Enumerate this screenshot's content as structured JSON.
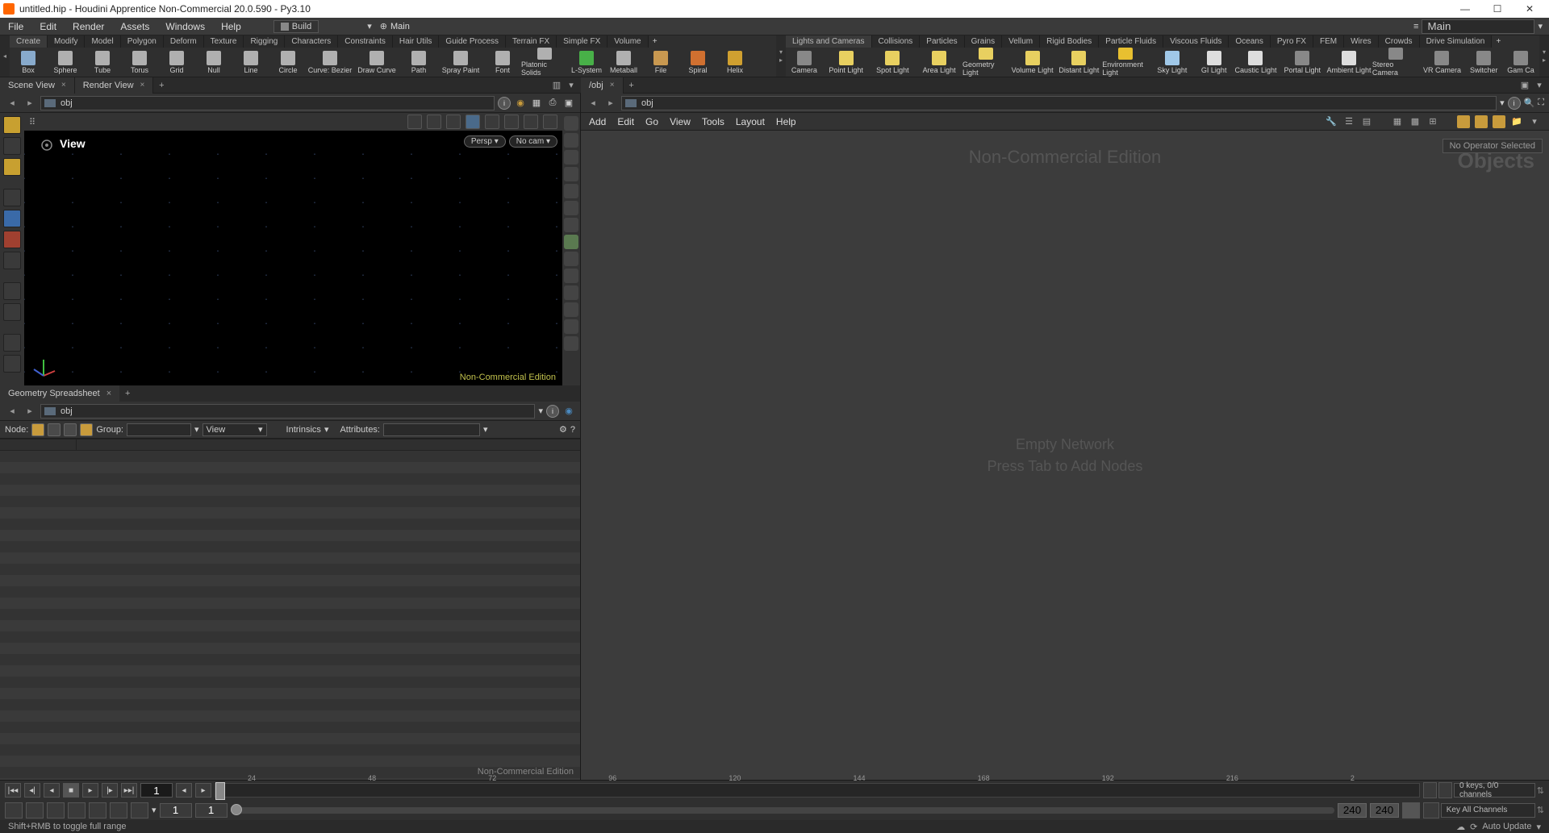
{
  "titlebar": {
    "title": "untitled.hip - Houdini Apprentice Non-Commercial 20.0.590 - Py3.10"
  },
  "menubar": {
    "items": [
      "File",
      "Edit",
      "Render",
      "Assets",
      "Windows",
      "Help"
    ],
    "build_label": "Build",
    "main_label": "Main",
    "right_input_value": "Main"
  },
  "shelf": {
    "left_tabs": [
      "Create",
      "Modify",
      "Model",
      "Polygon",
      "Deform",
      "Texture",
      "Rigging",
      "Characters",
      "Constraints",
      "Hair Utils",
      "Guide Process",
      "Terrain FX",
      "Simple FX",
      "Volume"
    ],
    "left_tools": [
      {
        "label": "Box",
        "c": "#88aacc"
      },
      {
        "label": "Sphere",
        "c": "#b0b0b0"
      },
      {
        "label": "Tube",
        "c": "#b0b0b0"
      },
      {
        "label": "Torus",
        "c": "#b0b0b0"
      },
      {
        "label": "Grid",
        "c": "#b0b0b0"
      },
      {
        "label": "Null",
        "c": "#b0b0b0"
      },
      {
        "label": "Line",
        "c": "#b0b0b0"
      },
      {
        "label": "Circle",
        "c": "#b0b0b0"
      },
      {
        "label": "Curve: Bezier",
        "c": "#b0b0b0"
      },
      {
        "label": "Draw Curve",
        "c": "#b0b0b0"
      },
      {
        "label": "Path",
        "c": "#b0b0b0"
      },
      {
        "label": "Spray Paint",
        "c": "#b0b0b0"
      },
      {
        "label": "Font",
        "c": "#b0b0b0"
      },
      {
        "label": "Platonic Solids",
        "c": "#b0b0b0"
      },
      {
        "label": "L-System",
        "c": "#48b048"
      },
      {
        "label": "Metaball",
        "c": "#b0b0b0"
      },
      {
        "label": "File",
        "c": "#c89850"
      },
      {
        "label": "Spiral",
        "c": "#d07030"
      },
      {
        "label": "Helix",
        "c": "#d0a030"
      }
    ],
    "right_tabs": [
      "Lights and Cameras",
      "Collisions",
      "Particles",
      "Grains",
      "Vellum",
      "Rigid Bodies",
      "Particle Fluids",
      "Viscous Fluids",
      "Oceans",
      "Pyro FX",
      "FEM",
      "Wires",
      "Crowds",
      "Drive Simulation"
    ],
    "right_tools": [
      {
        "label": "Camera",
        "c": "#888"
      },
      {
        "label": "Point Light",
        "c": "#e8d060"
      },
      {
        "label": "Spot Light",
        "c": "#e8d060"
      },
      {
        "label": "Area Light",
        "c": "#e8d060"
      },
      {
        "label": "Geometry Light",
        "c": "#e8d060"
      },
      {
        "label": "Volume Light",
        "c": "#e8d060"
      },
      {
        "label": "Distant Light",
        "c": "#e8d060"
      },
      {
        "label": "Environment Light",
        "c": "#e8c030"
      },
      {
        "label": "Sky Light",
        "c": "#a0c8e8"
      },
      {
        "label": "GI Light",
        "c": "#ddd"
      },
      {
        "label": "Caustic Light",
        "c": "#ddd"
      },
      {
        "label": "Portal Light",
        "c": "#888"
      },
      {
        "label": "Ambient Light",
        "c": "#ddd"
      },
      {
        "label": "Stereo Camera",
        "c": "#888"
      },
      {
        "label": "VR Camera",
        "c": "#888"
      },
      {
        "label": "Switcher",
        "c": "#888"
      },
      {
        "label": "Gam Ca",
        "c": "#888"
      }
    ]
  },
  "left_pane": {
    "tabs": [
      "Scene View",
      "Render View"
    ],
    "path": "obj",
    "view_label": "View",
    "cam_pill_1": "Persp ▾",
    "cam_pill_2": "No cam ▾",
    "watermark": "Non-Commercial Edition"
  },
  "spreadsheet": {
    "tab": "Geometry Spreadsheet",
    "path": "obj",
    "node_label": "Node:",
    "group_label": "Group:",
    "view_label": "View",
    "intrinsics_label": "Intrinsics",
    "attributes_label": "Attributes:",
    "watermark": "Non-Commercial Edition"
  },
  "network": {
    "tab": "/obj",
    "path": "obj",
    "menus": [
      "Add",
      "Edit",
      "Go",
      "View",
      "Tools",
      "Layout",
      "Help"
    ],
    "watermark": "Non-Commercial Edition",
    "objects_label": "Objects",
    "noop": "No Operator Selected",
    "empty_l1": "Empty Network",
    "empty_l2": "Press Tab to Add Nodes"
  },
  "timeline": {
    "ticks": [
      "24",
      "48",
      "72",
      "96",
      "120",
      "144",
      "168",
      "192",
      "216",
      "2"
    ],
    "cur_frame": "1",
    "start": "1",
    "start2": "1",
    "end": "240",
    "end2": "240",
    "keys_label": "0 keys, 0/0 channels",
    "keyall_label": "Key All Channels",
    "auto_update": "Auto Update"
  },
  "statusbar": {
    "text": "Shift+RMB to toggle full range"
  }
}
